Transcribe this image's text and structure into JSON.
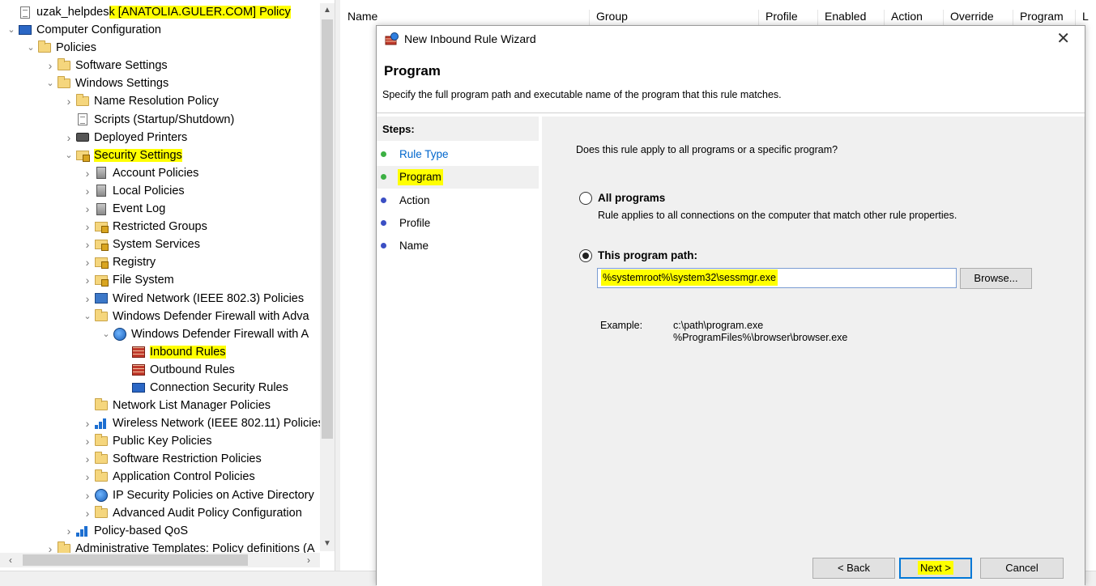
{
  "tree": {
    "items": [
      {
        "label_plain": "uzak_helpdes",
        "label_hl": "k [ANATOLIA.GULER.COM] Policy",
        "level": 0,
        "expander": "",
        "icon": "doc"
      },
      {
        "label_plain": "Computer Configuration",
        "label_hl": "",
        "level": 0,
        "expander": "v",
        "icon": "pc"
      },
      {
        "label_plain": "Policies",
        "label_hl": "",
        "level": 1,
        "expander": "v",
        "icon": "folder"
      },
      {
        "label_plain": "Software Settings",
        "label_hl": "",
        "level": 2,
        "expander": ">",
        "icon": "folder"
      },
      {
        "label_plain": "Windows Settings",
        "label_hl": "",
        "level": 2,
        "expander": "v",
        "icon": "folder"
      },
      {
        "label_plain": "Name Resolution Policy",
        "label_hl": "",
        "level": 3,
        "expander": ">",
        "icon": "folder"
      },
      {
        "label_plain": "Scripts (Startup/Shutdown)",
        "label_hl": "",
        "level": 3,
        "expander": "",
        "icon": "doc"
      },
      {
        "label_plain": "Deployed Printers",
        "label_hl": "",
        "level": 3,
        "expander": ">",
        "icon": "printer"
      },
      {
        "label_plain": "",
        "label_hl": "Security Settings",
        "level": 3,
        "expander": "v",
        "icon": "lockfolder"
      },
      {
        "label_plain": "Account Policies",
        "label_hl": "",
        "level": 4,
        "expander": ">",
        "icon": "server"
      },
      {
        "label_plain": "Local Policies",
        "label_hl": "",
        "level": 4,
        "expander": ">",
        "icon": "server"
      },
      {
        "label_plain": "Event Log",
        "label_hl": "",
        "level": 4,
        "expander": ">",
        "icon": "server"
      },
      {
        "label_plain": "Restricted Groups",
        "label_hl": "",
        "level": 4,
        "expander": ">",
        "icon": "lockfolder"
      },
      {
        "label_plain": "System Services",
        "label_hl": "",
        "level": 4,
        "expander": ">",
        "icon": "lockfolder"
      },
      {
        "label_plain": "Registry",
        "label_hl": "",
        "level": 4,
        "expander": ">",
        "icon": "lockfolder"
      },
      {
        "label_plain": "File System",
        "label_hl": "",
        "level": 4,
        "expander": ">",
        "icon": "lockfolder"
      },
      {
        "label_plain": "Wired Network (IEEE 802.3) Policies",
        "label_hl": "",
        "level": 4,
        "expander": ">",
        "icon": "net"
      },
      {
        "label_plain": "Windows Defender Firewall with Adva",
        "label_hl": "",
        "level": 4,
        "expander": "v",
        "icon": "folder"
      },
      {
        "label_plain": "Windows Defender Firewall with A",
        "label_hl": "",
        "level": 5,
        "expander": "v",
        "icon": "globe"
      },
      {
        "label_plain": "",
        "label_hl": "Inbound Rules",
        "level": 6,
        "expander": "",
        "icon": "firewall"
      },
      {
        "label_plain": "Outbound Rules",
        "label_hl": "",
        "level": 6,
        "expander": "",
        "icon": "firewall"
      },
      {
        "label_plain": "Connection Security Rules",
        "label_hl": "",
        "level": 6,
        "expander": "",
        "icon": "pc"
      },
      {
        "label_plain": "Network List Manager Policies",
        "label_hl": "",
        "level": 4,
        "expander": "",
        "icon": "folder"
      },
      {
        "label_plain": "Wireless Network (IEEE 802.11) Policies",
        "label_hl": "",
        "level": 4,
        "expander": ">",
        "icon": "chart"
      },
      {
        "label_plain": "Public Key Policies",
        "label_hl": "",
        "level": 4,
        "expander": ">",
        "icon": "folder"
      },
      {
        "label_plain": "Software Restriction Policies",
        "label_hl": "",
        "level": 4,
        "expander": ">",
        "icon": "folder"
      },
      {
        "label_plain": "Application Control Policies",
        "label_hl": "",
        "level": 4,
        "expander": ">",
        "icon": "folder"
      },
      {
        "label_plain": "IP Security Policies on Active Directory",
        "label_hl": "",
        "level": 4,
        "expander": ">",
        "icon": "globe"
      },
      {
        "label_plain": "Advanced Audit Policy Configuration",
        "label_hl": "",
        "level": 4,
        "expander": ">",
        "icon": "folder"
      },
      {
        "label_plain": "Policy-based QoS",
        "label_hl": "",
        "level": 3,
        "expander": ">",
        "icon": "chart"
      },
      {
        "label_plain": "Administrative Templates: Policy definitions (A",
        "label_hl": "",
        "level": 2,
        "expander": ">",
        "icon": "folder"
      }
    ]
  },
  "list": {
    "columns": [
      "Name",
      "Group",
      "Profile",
      "Enabled",
      "Action",
      "Override",
      "Program",
      "L"
    ]
  },
  "wizard": {
    "title": "New Inbound Rule Wizard",
    "close_glyph": "✕",
    "heading": "Program",
    "subtitle": "Specify the full program path and executable name of the program that this rule matches.",
    "steps_title": "Steps:",
    "steps": [
      {
        "label": "Rule Type",
        "state": "done"
      },
      {
        "label": "Program",
        "state": "current"
      },
      {
        "label": "Action",
        "state": "pending"
      },
      {
        "label": "Profile",
        "state": "pending"
      },
      {
        "label": "Name",
        "state": "pending"
      }
    ],
    "question": "Does this rule apply to all programs or a specific program?",
    "all_programs_label": "All programs",
    "all_programs_desc": "Rule applies to all connections on the computer that match other rule properties.",
    "this_program_label": "This program path:",
    "path_value": "%systemroot%\\system32\\sessmgr.exe",
    "browse_label": "Browse...",
    "example_label": "Example:",
    "example_line1": "c:\\path\\program.exe",
    "example_line2": "%ProgramFiles%\\browser\\browser.exe",
    "back_label": "< Back",
    "next_label": "Next >",
    "cancel_label": "Cancel"
  },
  "colors": {
    "highlight": "#ffff00",
    "step_done": "#3cb043",
    "step_pending": "#3b4fc4",
    "link_blue": "#0066cc"
  }
}
